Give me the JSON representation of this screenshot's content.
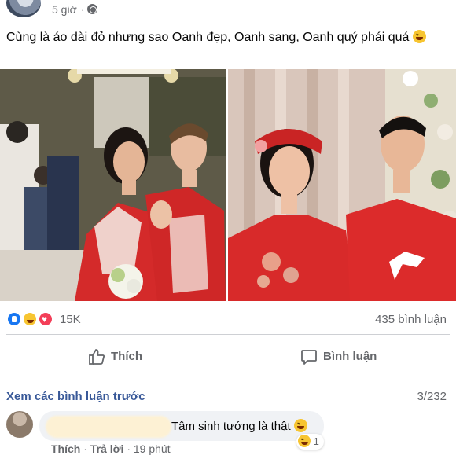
{
  "post": {
    "time": "5 giờ",
    "separator": "·",
    "text": "Cùng là áo dài đỏ nhưng sao Oanh đẹp, Oanh sang, Oanh quý phái quá"
  },
  "reactions": {
    "count": "15K",
    "comments": "435 bình luận",
    "icons": [
      "like-icon",
      "haha-icon",
      "love-icon"
    ]
  },
  "actions": {
    "like_label": "Thích",
    "comment_label": "Bình luận"
  },
  "comments_section": {
    "view_more": "Xem các bình luận trước",
    "paging": "3/232",
    "comment": {
      "text": "Tâm sinh tướng là thật",
      "reaction_count": "1",
      "like": "Thích",
      "reply": "Trả lời",
      "time": "19 phút",
      "sep": "·"
    }
  },
  "colors": {
    "accent_like": "#1877f2",
    "link": "#385898",
    "muted": "#65676b",
    "dress_red": "#d42a2a"
  }
}
